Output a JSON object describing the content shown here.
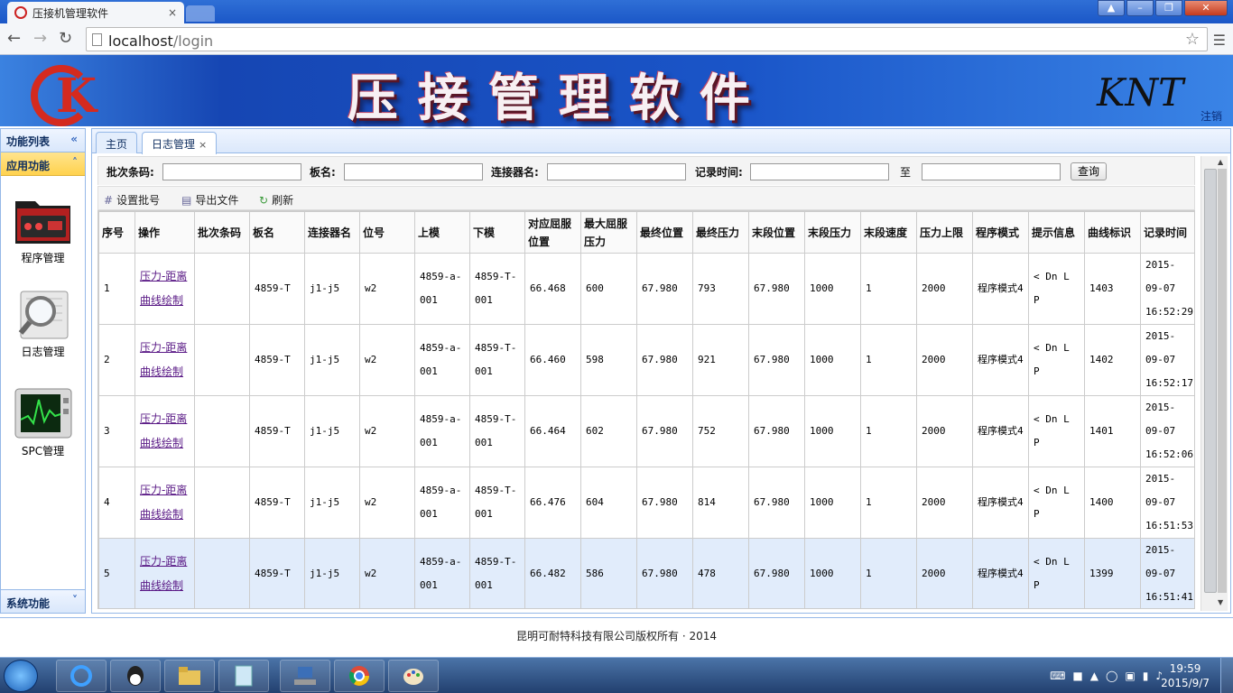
{
  "browser": {
    "tab_title": "压接机管理软件",
    "tab_close": "×",
    "url_host": "localhost",
    "url_path": "/login"
  },
  "banner": {
    "title": "压接管理软件",
    "brand": "KNT",
    "logout": "注销"
  },
  "sidebar": {
    "header": "功能列表",
    "section_app": "应用功能",
    "items": [
      {
        "label": "程序管理",
        "icon": "folder-device-icon"
      },
      {
        "label": "日志管理",
        "icon": "magnifier-log-icon"
      },
      {
        "label": "SPC管理",
        "icon": "monitor-chart-icon"
      }
    ],
    "section_sys": "系统功能"
  },
  "tabs": [
    {
      "label": "主页",
      "closable": false
    },
    {
      "label": "日志管理",
      "closable": true
    }
  ],
  "filters": {
    "batch_label": "批次条码:",
    "board_label": "板名:",
    "connector_label": "连接器名:",
    "time_label": "记录时间:",
    "to_label": "至",
    "query_button": "查询"
  },
  "actions": {
    "set_batch": "设置批号",
    "export": "导出文件",
    "refresh": "刷新"
  },
  "table": {
    "columns": [
      "序号",
      "操作",
      "批次条码",
      "板名",
      "连接器名",
      "位号",
      "上模",
      "下模",
      "对应屈服位置",
      "最大屈服压力",
      "最终位置",
      "最终压力",
      "末段位置",
      "末段压力",
      "末段速度",
      "压力上限",
      "程序模式",
      "提示信息",
      "曲线标识",
      "记录时间"
    ],
    "rows": [
      {
        "seq": "1",
        "op": "压力-距离曲线绘制",
        "batch": "",
        "board": "4859-T",
        "conn": "j1-j5",
        "pos": "w2",
        "upper": "4859-a-001",
        "lower": "4859-T-001",
        "yield_pos": "66.468",
        "max_yield": "600",
        "final_pos": "67.980",
        "final_pres": "793",
        "end_pos": "67.980",
        "end_pres": "1000",
        "end_speed": "1",
        "pres_limit": "2000",
        "mode": "程序模式4",
        "hint": "< Dn L P",
        "curve": "1403",
        "time": "2015-09-07 16:52:29"
      },
      {
        "seq": "2",
        "op": "压力-距离曲线绘制",
        "batch": "",
        "board": "4859-T",
        "conn": "j1-j5",
        "pos": "w2",
        "upper": "4859-a-001",
        "lower": "4859-T-001",
        "yield_pos": "66.460",
        "max_yield": "598",
        "final_pos": "67.980",
        "final_pres": "921",
        "end_pos": "67.980",
        "end_pres": "1000",
        "end_speed": "1",
        "pres_limit": "2000",
        "mode": "程序模式4",
        "hint": "< Dn L P",
        "curve": "1402",
        "time": "2015-09-07 16:52:17"
      },
      {
        "seq": "3",
        "op": "压力-距离曲线绘制",
        "batch": "",
        "board": "4859-T",
        "conn": "j1-j5",
        "pos": "w2",
        "upper": "4859-a-001",
        "lower": "4859-T-001",
        "yield_pos": "66.464",
        "max_yield": "602",
        "final_pos": "67.980",
        "final_pres": "752",
        "end_pos": "67.980",
        "end_pres": "1000",
        "end_speed": "1",
        "pres_limit": "2000",
        "mode": "程序模式4",
        "hint": "< Dn L P",
        "curve": "1401",
        "time": "2015-09-07 16:52:06"
      },
      {
        "seq": "4",
        "op": "压力-距离曲线绘制",
        "batch": "",
        "board": "4859-T",
        "conn": "j1-j5",
        "pos": "w2",
        "upper": "4859-a-001",
        "lower": "4859-T-001",
        "yield_pos": "66.476",
        "max_yield": "604",
        "final_pos": "67.980",
        "final_pres": "814",
        "end_pos": "67.980",
        "end_pres": "1000",
        "end_speed": "1",
        "pres_limit": "2000",
        "mode": "程序模式4",
        "hint": "< Dn L P",
        "curve": "1400",
        "time": "2015-09-07 16:51:53"
      },
      {
        "seq": "5",
        "op": "压力-距离曲线绘制",
        "batch": "",
        "board": "4859-T",
        "conn": "j1-j5",
        "pos": "w2",
        "upper": "4859-a-001",
        "lower": "4859-T-001",
        "yield_pos": "66.482",
        "max_yield": "586",
        "final_pos": "67.980",
        "final_pres": "478",
        "end_pos": "67.980",
        "end_pres": "1000",
        "end_speed": "1",
        "pres_limit": "2000",
        "mode": "程序模式4",
        "hint": "< Dn L P",
        "curve": "1399",
        "time": "2015-09-07 16:51:41"
      }
    ],
    "selected_row": 5
  },
  "footer": "昆明可耐特科技有限公司版权所有 · 2014",
  "taskbar": {
    "apps": [
      "ie-icon",
      "qq-icon",
      "explorer-icon",
      "notepad-icon",
      "network-icon",
      "chrome-icon",
      "paint-icon"
    ],
    "time": "19:59",
    "date": "2015/9/7"
  }
}
